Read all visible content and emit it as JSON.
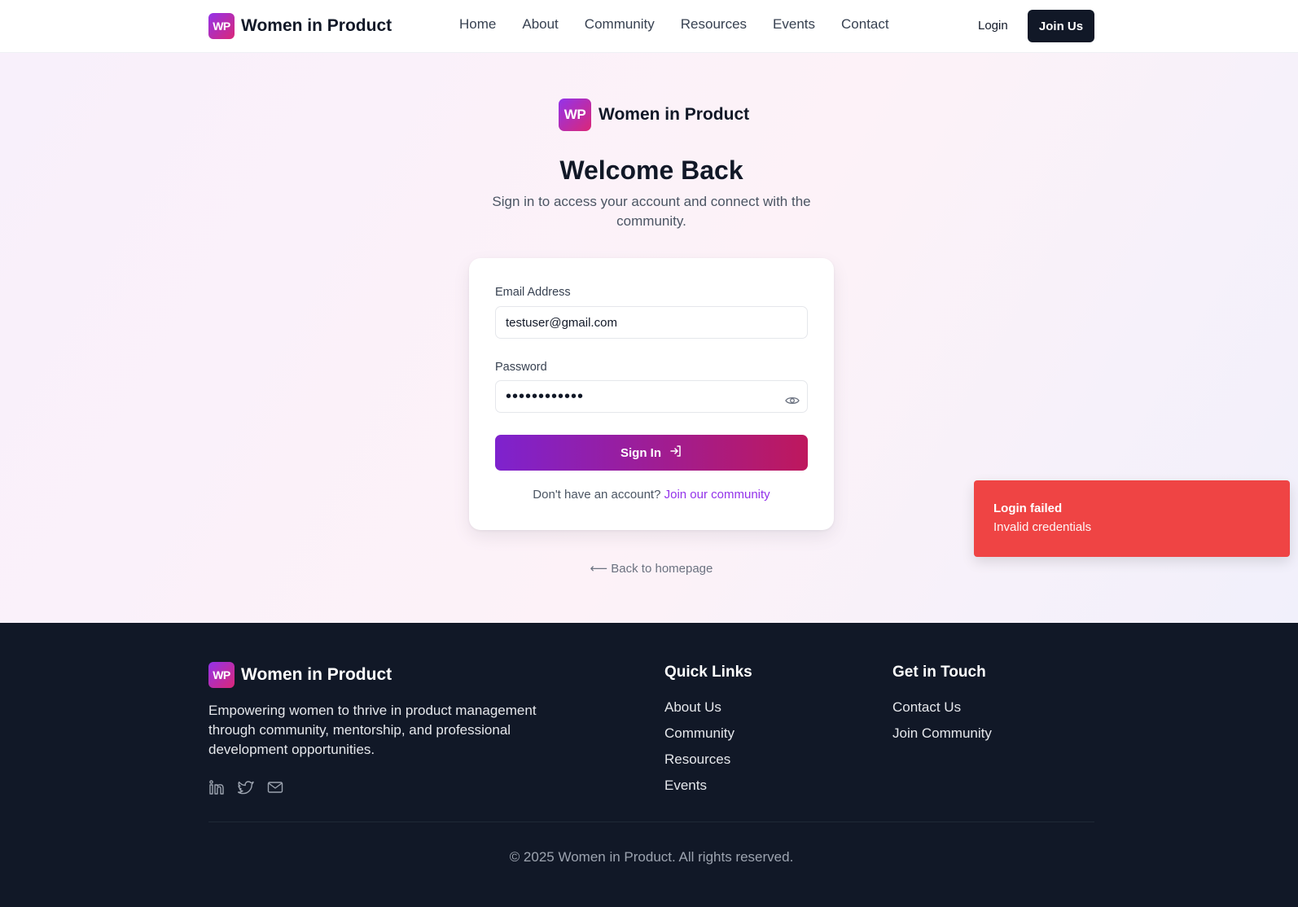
{
  "brand": {
    "logo_text": "WP",
    "name": "Women in Product"
  },
  "colors": {
    "accent_start": "#7e22ce",
    "accent_end": "#be185d",
    "toast_bg": "#ef4444",
    "footer_bg": "#111827"
  },
  "header": {
    "nav": [
      "Home",
      "About",
      "Community",
      "Resources",
      "Events",
      "Contact"
    ],
    "login_label": "Login",
    "join_label": "Join Us"
  },
  "login": {
    "title": "Welcome Back",
    "subtitle": "Sign in to access your account and connect with the community.",
    "email_label": "Email Address",
    "email_value": "testuser@gmail.com",
    "password_label": "Password",
    "password_value": "••••••••••••",
    "password_toggle_icon": "eye-icon",
    "submit_label": "Sign In",
    "submit_icon": "sign-in-arrow-icon",
    "signup_prompt": "Don't have an account?",
    "signup_link": "Join our community",
    "back_link": "⟵ Back to homepage"
  },
  "toast": {
    "title": "Login failed",
    "message": "Invalid credentials"
  },
  "footer": {
    "description": "Empowering women to thrive in product management through community, mentorship, and professional development opportunities.",
    "socials": [
      "linkedin-icon",
      "twitter-icon",
      "mail-icon"
    ],
    "quick_links_title": "Quick Links",
    "quick_links": [
      "About Us",
      "Community",
      "Resources",
      "Events"
    ],
    "contact_title": "Get in Touch",
    "contact_links": [
      "Contact Us",
      "Join Community"
    ],
    "copyright": "© 2025 Women in Product. All rights reserved."
  }
}
